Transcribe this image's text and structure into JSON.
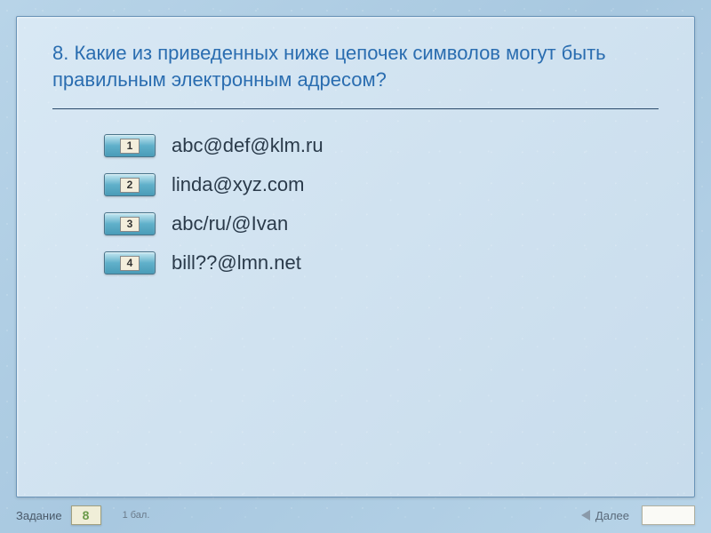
{
  "question": "8. Какие из приведенных ниже цепочек символов могут быть правильным электронным адресом?",
  "options": [
    {
      "num": "1",
      "text": "abc@def@klm.ru"
    },
    {
      "num": "2",
      "text": "linda@xyz.com"
    },
    {
      "num": "3",
      "text": "abc/ru/@Ivan"
    },
    {
      "num": "4",
      "text": "bill??@lmn.net"
    }
  ],
  "footer": {
    "label": "Задание",
    "current": "8",
    "score": "1 бал.",
    "next": "Далее"
  }
}
